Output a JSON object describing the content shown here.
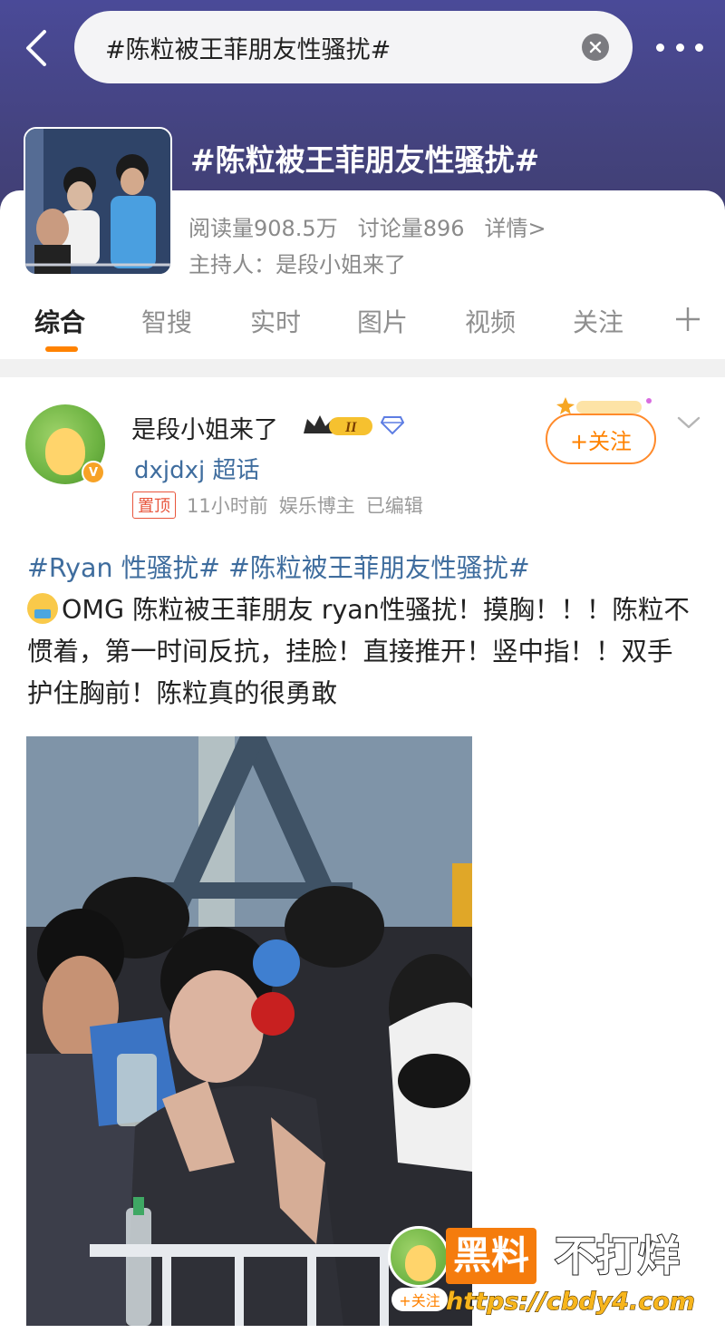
{
  "search": {
    "query": "#陈粒被王菲朋友性骚扰#"
  },
  "topic": {
    "title": "#陈粒被王菲朋友性骚扰#",
    "reads": "阅读量908.5万",
    "discussions": "讨论量896",
    "details": "详情>",
    "host": "主持人：是段小姐来了"
  },
  "tabs": [
    {
      "label": "综合",
      "active": true
    },
    {
      "label": "智搜"
    },
    {
      "label": "实时"
    },
    {
      "label": "图片"
    },
    {
      "label": "视频"
    },
    {
      "label": "关注"
    }
  ],
  "post": {
    "author": "是段小姐来了",
    "badge_level": "II",
    "sub": "dxjdxj 超话",
    "pinned": "置顶",
    "time": "11小时前",
    "role": "娱乐博主",
    "edited": "已编辑",
    "follow_label": "+关注",
    "hashtags": "#Ryan 性骚扰# #陈粒被王菲朋友性骚扰#",
    "text": "OMG 陈粒被王菲朋友 ryan性骚扰！摸胸！！！陈粒不惯着，第一时间反抗，挂脸！直接推开！竖中指！！双手护住胸前！陈粒真的很勇敢"
  },
  "watermark": {
    "follow": "+关注",
    "brand": "黑料",
    "brand2": "不打烊",
    "url": "https://cbdy4.com"
  },
  "colors": {
    "accent": "#ff8200",
    "link": "#3f6d9e",
    "header": "#44437f"
  }
}
